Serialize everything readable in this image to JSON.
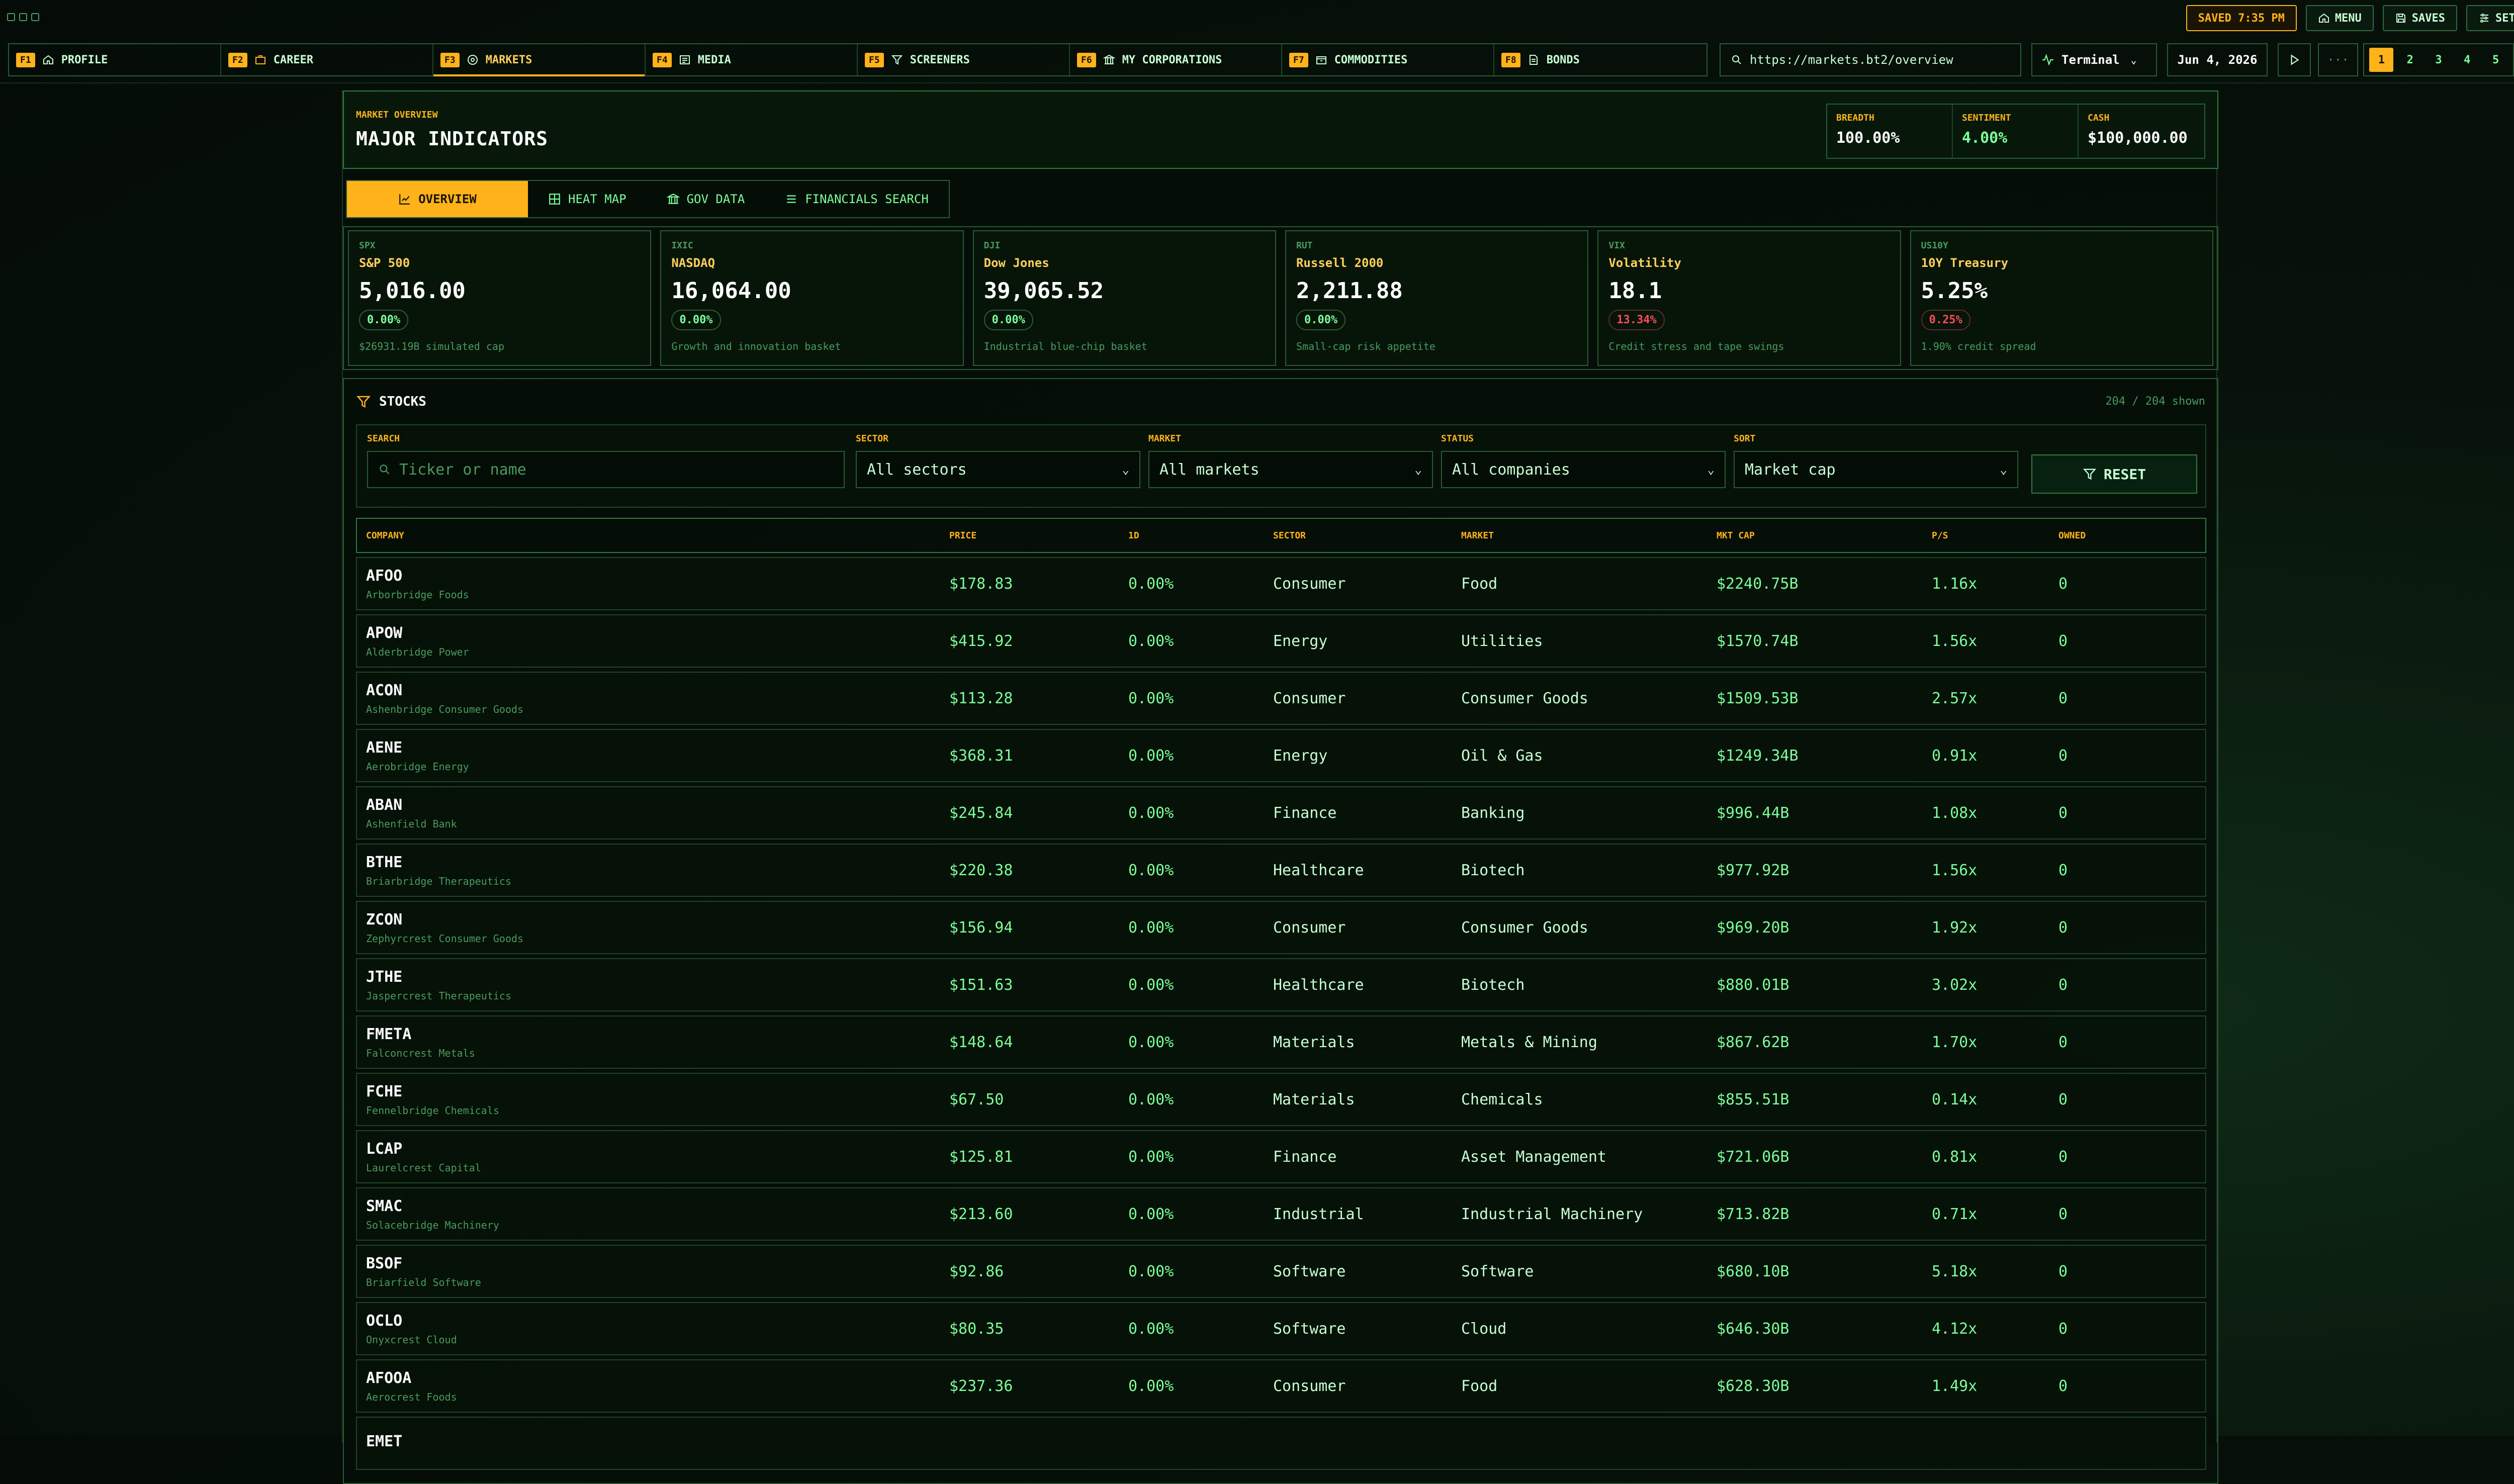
{
  "top": {
    "saved": "SAVED 7:35 PM",
    "menu": "MENU",
    "saves": "SAVES",
    "settings": "SETTINGS"
  },
  "nav": [
    {
      "key": "F1",
      "label": "PROFILE",
      "icon": "home-icon"
    },
    {
      "key": "F2",
      "label": "CAREER",
      "icon": "briefcase-icon"
    },
    {
      "key": "F3",
      "label": "MARKETS",
      "icon": "globe-icon"
    },
    {
      "key": "F4",
      "label": "MEDIA",
      "icon": "newspaper-icon"
    },
    {
      "key": "F5",
      "label": "SCREENERS",
      "icon": "filter-icon"
    },
    {
      "key": "F6",
      "label": "MY CORPORATIONS",
      "icon": "building-icon"
    },
    {
      "key": "F7",
      "label": "COMMODITIES",
      "icon": "crate-icon"
    },
    {
      "key": "F8",
      "label": "BONDS",
      "icon": "document-icon"
    }
  ],
  "url": "https://markets.bt2/overview",
  "terminal": "Terminal",
  "date": "Jun 4, 2026",
  "more": "···",
  "pages": [
    "1",
    "2",
    "3",
    "4",
    "5"
  ],
  "header": {
    "eyebrow": "MARKET OVERVIEW",
    "title": "MAJOR INDICATORS",
    "stats": [
      {
        "label": "BREADTH",
        "value": "100.00%"
      },
      {
        "label": "SENTIMENT",
        "value": "4.00%"
      },
      {
        "label": "CASH",
        "value": "$100,000.00"
      }
    ]
  },
  "subtabs": [
    "OVERVIEW",
    "HEAT MAP",
    "GOV DATA",
    "FINANCIALS SEARCH"
  ],
  "indices": [
    {
      "ticker": "SPX",
      "name": "S&P 500",
      "price": "5,016.00",
      "change": "0.00%",
      "negative": false,
      "note": "$26931.19B simulated cap"
    },
    {
      "ticker": "IXIC",
      "name": "NASDAQ",
      "price": "16,064.00",
      "change": "0.00%",
      "negative": false,
      "note": "Growth and innovation basket"
    },
    {
      "ticker": "DJI",
      "name": "Dow Jones",
      "price": "39,065.52",
      "change": "0.00%",
      "negative": false,
      "note": "Industrial blue-chip basket"
    },
    {
      "ticker": "RUT",
      "name": "Russell 2000",
      "price": "2,211.88",
      "change": "0.00%",
      "negative": false,
      "note": "Small-cap risk appetite"
    },
    {
      "ticker": "VIX",
      "name": "Volatility",
      "price": "18.1",
      "change": "13.34%",
      "negative": true,
      "note": "Credit stress and tape swings"
    },
    {
      "ticker": "US10Y",
      "name": "10Y Treasury",
      "price": "5.25%",
      "change": "0.25%",
      "negative": true,
      "note": "1.90% credit spread"
    }
  ],
  "stocks": {
    "title": "STOCKS",
    "shown": "204 / 204 shown",
    "filters": {
      "search_label": "SEARCH",
      "search_placeholder": "Ticker or name",
      "sector_label": "SECTOR",
      "sector_value": "All sectors",
      "market_label": "MARKET",
      "market_value": "All markets",
      "status_label": "STATUS",
      "status_value": "All companies",
      "sort_label": "SORT",
      "sort_value": "Market cap",
      "reset": "RESET"
    },
    "columns": [
      "COMPANY",
      "PRICE",
      "1D",
      "SECTOR",
      "MARKET",
      "MKT CAP",
      "P/S",
      "OWNED"
    ],
    "rows": [
      {
        "ticker": "AFOO",
        "name": "Arborbridge Foods",
        "price": "$178.83",
        "d1": "0.00%",
        "sector": "Consumer",
        "market": "Food",
        "cap": "$2240.75B",
        "ps": "1.16x",
        "owned": "0"
      },
      {
        "ticker": "APOW",
        "name": "Alderbridge Power",
        "price": "$415.92",
        "d1": "0.00%",
        "sector": "Energy",
        "market": "Utilities",
        "cap": "$1570.74B",
        "ps": "1.56x",
        "owned": "0"
      },
      {
        "ticker": "ACON",
        "name": "Ashenbridge Consumer Goods",
        "price": "$113.28",
        "d1": "0.00%",
        "sector": "Consumer",
        "market": "Consumer Goods",
        "cap": "$1509.53B",
        "ps": "2.57x",
        "owned": "0"
      },
      {
        "ticker": "AENE",
        "name": "Aerobridge Energy",
        "price": "$368.31",
        "d1": "0.00%",
        "sector": "Energy",
        "market": "Oil & Gas",
        "cap": "$1249.34B",
        "ps": "0.91x",
        "owned": "0"
      },
      {
        "ticker": "ABAN",
        "name": "Ashenfield Bank",
        "price": "$245.84",
        "d1": "0.00%",
        "sector": "Finance",
        "market": "Banking",
        "cap": "$996.44B",
        "ps": "1.08x",
        "owned": "0"
      },
      {
        "ticker": "BTHE",
        "name": "Briarbridge Therapeutics",
        "price": "$220.38",
        "d1": "0.00%",
        "sector": "Healthcare",
        "market": "Biotech",
        "cap": "$977.92B",
        "ps": "1.56x",
        "owned": "0"
      },
      {
        "ticker": "ZCON",
        "name": "Zephyrcrest Consumer Goods",
        "price": "$156.94",
        "d1": "0.00%",
        "sector": "Consumer",
        "market": "Consumer Goods",
        "cap": "$969.20B",
        "ps": "1.92x",
        "owned": "0"
      },
      {
        "ticker": "JTHE",
        "name": "Jaspercrest Therapeutics",
        "price": "$151.63",
        "d1": "0.00%",
        "sector": "Healthcare",
        "market": "Biotech",
        "cap": "$880.01B",
        "ps": "3.02x",
        "owned": "0"
      },
      {
        "ticker": "FMETA",
        "name": "Falconcrest Metals",
        "price": "$148.64",
        "d1": "0.00%",
        "sector": "Materials",
        "market": "Metals & Mining",
        "cap": "$867.62B",
        "ps": "1.70x",
        "owned": "0"
      },
      {
        "ticker": "FCHE",
        "name": "Fennelbridge Chemicals",
        "price": "$67.50",
        "d1": "0.00%",
        "sector": "Materials",
        "market": "Chemicals",
        "cap": "$855.51B",
        "ps": "0.14x",
        "owned": "0"
      },
      {
        "ticker": "LCAP",
        "name": "Laurelcrest Capital",
        "price": "$125.81",
        "d1": "0.00%",
        "sector": "Finance",
        "market": "Asset Management",
        "cap": "$721.06B",
        "ps": "0.81x",
        "owned": "0"
      },
      {
        "ticker": "SMAC",
        "name": "Solacebridge Machinery",
        "price": "$213.60",
        "d1": "0.00%",
        "sector": "Industrial",
        "market": "Industrial Machinery",
        "cap": "$713.82B",
        "ps": "0.71x",
        "owned": "0"
      },
      {
        "ticker": "BSOF",
        "name": "Briarfield Software",
        "price": "$92.86",
        "d1": "0.00%",
        "sector": "Software",
        "market": "Software",
        "cap": "$680.10B",
        "ps": "5.18x",
        "owned": "0"
      },
      {
        "ticker": "OCLO",
        "name": "Onyxcrest Cloud",
        "price": "$80.35",
        "d1": "0.00%",
        "sector": "Software",
        "market": "Cloud",
        "cap": "$646.30B",
        "ps": "4.12x",
        "owned": "0"
      },
      {
        "ticker": "AFOOA",
        "name": "Aerocrest Foods",
        "price": "$237.36",
        "d1": "0.00%",
        "sector": "Consumer",
        "market": "Food",
        "cap": "$628.30B",
        "ps": "1.49x",
        "owned": "0"
      },
      {
        "ticker": "EMET",
        "name": "",
        "price": "",
        "d1": "",
        "sector": "",
        "market": "",
        "cap": "",
        "ps": "",
        "owned": ""
      }
    ]
  }
}
